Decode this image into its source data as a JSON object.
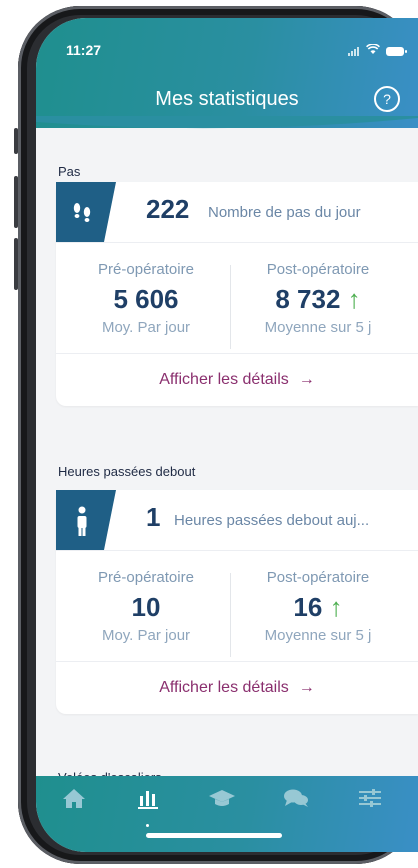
{
  "status": {
    "time": "11:27"
  },
  "header": {
    "title": "Mes statistiques"
  },
  "sections": [
    {
      "label": "Pas",
      "value": "222",
      "value_label": "Nombre de pas du jour",
      "pre": {
        "title": "Pré-opératoire",
        "value": "5 606",
        "sub": "Moy. Par jour"
      },
      "post": {
        "title": "Post-opératoire",
        "value": "8 732",
        "trend": "↑",
        "sub": "Moyenne sur 5 j"
      },
      "details": "Afficher les détails",
      "details_arrow": "→"
    },
    {
      "label": "Heures passées debout",
      "value": "1",
      "value_label": "Heures passées debout auj...",
      "pre": {
        "title": "Pré-opératoire",
        "value": "10",
        "sub": "Moy. Par jour"
      },
      "post": {
        "title": "Post-opératoire",
        "value": "16",
        "trend": "↑",
        "sub": "Moyenne sur 5 j"
      },
      "details": "Afficher les détails",
      "details_arrow": "→"
    }
  ],
  "next_section_label": "Volées d'escaliers",
  "tabbar": {
    "items": [
      {
        "icon": "home-icon"
      },
      {
        "icon": "stats-icon",
        "active": true
      },
      {
        "icon": "graduation-cap-icon"
      },
      {
        "icon": "chat-icon"
      },
      {
        "icon": "settings-sliders-icon"
      }
    ]
  },
  "colors": {
    "header_start": "#1f8f8e",
    "header_end": "#3a8fc6",
    "icon_tab": "#1f5f86",
    "value_text": "#1f3f66",
    "link": "#8a2f6e",
    "trend_up": "#4cae4f"
  }
}
